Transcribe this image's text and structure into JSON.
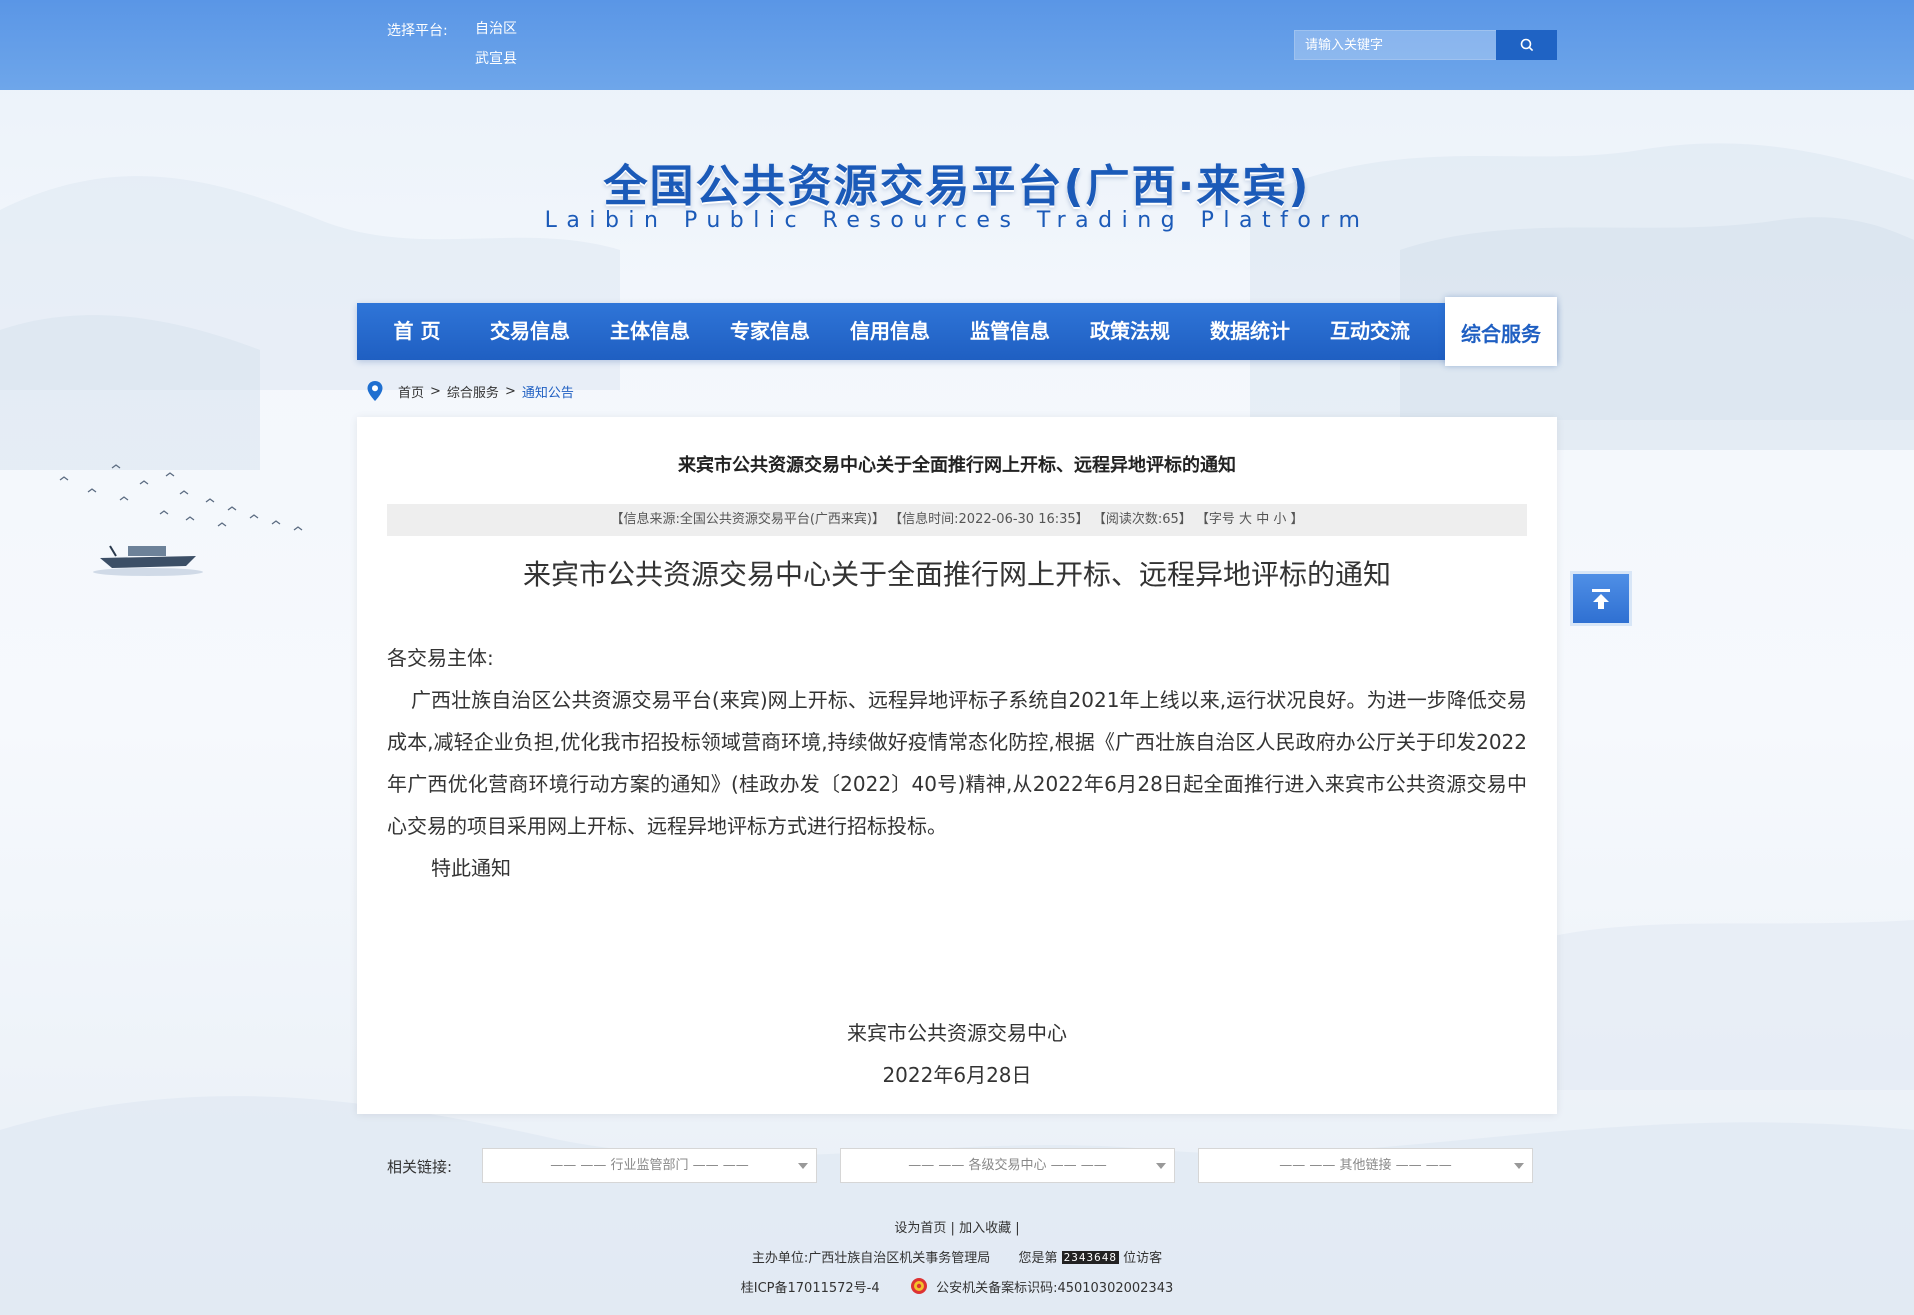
{
  "topbar": {
    "platform_label": "选择平台:",
    "platforms": [
      "自治区",
      "武宣县"
    ],
    "search_placeholder": "请输入关键字"
  },
  "site": {
    "title": "全国公共资源交易平台(广西·来宾)",
    "subtitle": "Laibin Public Resources Trading Platform"
  },
  "nav": {
    "items": [
      "首 页",
      "交易信息",
      "主体信息",
      "专家信息",
      "信用信息",
      "监管信息",
      "政策法规",
      "数据统计",
      "互动交流"
    ],
    "active": "综合服务"
  },
  "breadcrumb": {
    "home": "首页",
    "level1": "综合服务",
    "current": "通知公告",
    "separator": ">"
  },
  "article": {
    "title": "来宾市公共资源交易中心关于全面推行网上开标、远程异地评标的通知",
    "meta": {
      "source": "【信息来源:全国公共资源交易平台(广西来宾)】",
      "time": "【信息时间:2022-06-30 16:35】",
      "views": "【阅读次数:65】",
      "font_open": "【字号",
      "font_large": "大",
      "font_medium": "中",
      "font_small": "小",
      "font_close": "】"
    },
    "heading": "来宾市公共资源交易中心关于全面推行网上开标、远程异地评标的通知",
    "salutation": "各交易主体:",
    "paragraph": "广西壮族自治区公共资源交易平台(来宾)网上开标、远程异地评标子系统自2021年上线以来,运行状况良好。为进一步降低交易成本,减轻企业负担,优化我市招投标领域营商环境,持续做好疫情常态化防控,根据《广西壮族自治区人民政府办公厅关于印发2022 年广西优化营商环境行动方案的通知》(桂政办发〔2022〕40号)精神,从2022年6月28日起全面推行进入来宾市公共资源交易中心交易的项目采用网上开标、远程异地评标方式进行招标投标。",
    "closing": "特此通知",
    "signature": "来宾市公共资源交易中心",
    "date": "2022年6月28日"
  },
  "related": {
    "label": "相关链接:",
    "selects": [
      "—— —— 行业监管部门 —— ——",
      "—— —— 各级交易中心 —— ——",
      "—— —— 其他链接 —— ——"
    ]
  },
  "footer": {
    "set_home": "设为首页",
    "add_favorite": "加入收藏",
    "sponsor": "主办单位:广西壮族自治区机关事务管理局",
    "visitor_prefix": "您是第",
    "visitor_count": "2343648",
    "visitor_suffix": "位访客",
    "icp": "桂ICP备17011572号-4",
    "police": "公安机关备案标识码:45010302002343"
  },
  "colors": {
    "topbar": "#5a96e6",
    "nav": "#1f5fc2",
    "accent": "#1b5ab8"
  }
}
